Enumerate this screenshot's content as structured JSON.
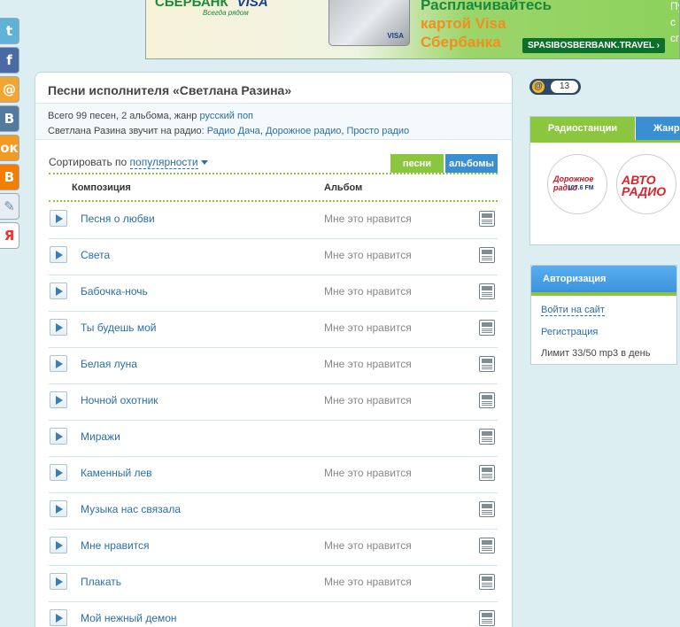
{
  "banner": {
    "bank": "СБЕРБАНК",
    "visa": "VISA",
    "slogan": "Всегда рядом",
    "card_visa": "VISA",
    "line1": "Расплачивайтесь",
    "line2": "картой Visa",
    "line3": "Сбербанка",
    "url": "SPASIBOSBERBANK.TRAVEL ›",
    "right_text1": "Пу",
    "right_text2": "с",
    "right_text3": "сп"
  },
  "social": [
    {
      "name": "twitter-icon",
      "glyph": "t"
    },
    {
      "name": "facebook-icon",
      "glyph": "f"
    },
    {
      "name": "mailru-icon",
      "glyph": "@"
    },
    {
      "name": "vkontakte-icon",
      "glyph": "B"
    },
    {
      "name": "odnoklassniki-icon",
      "glyph": "ок"
    },
    {
      "name": "blogger-icon",
      "glyph": "B"
    },
    {
      "name": "livejournal-icon",
      "glyph": "✎"
    },
    {
      "name": "yandex-icon",
      "glyph": "Я"
    }
  ],
  "main": {
    "title": "Песни исполнителя «Светлана Разина»",
    "info_prefix": "Всего 99 песен, 2 альбома, жанр ",
    "genre": "русский поп",
    "radio_prefix": "Светлана Разина звучит на радио: ",
    "radio1": "Радио Дача",
    "radio2": "Дорожное радио",
    "radio3": "Просто радио",
    "sep": ", ",
    "sort_label": "Сортировать по ",
    "sort_value": "популярности",
    "tab_songs": "песни",
    "tab_albums": "альбомы",
    "col_composition": "Композиция",
    "col_album": "Альбом"
  },
  "songs": [
    {
      "title": "Песня о любви",
      "album": "Мне это нравится"
    },
    {
      "title": "Света",
      "album": "Мне это нравится"
    },
    {
      "title": "Бабочка-ночь",
      "album": "Мне это нравится"
    },
    {
      "title": "Ты будешь мой",
      "album": "Мне это нравится"
    },
    {
      "title": "Белая луна",
      "album": "Мне это нравится"
    },
    {
      "title": "Ночной охотник",
      "album": "Мне это нравится"
    },
    {
      "title": "Миражи",
      "album": ""
    },
    {
      "title": "Каменный лев",
      "album": "Мне это нравится"
    },
    {
      "title": "Музыка нас связала",
      "album": ""
    },
    {
      "title": "Мне нравится",
      "album": "Мне это нравится"
    },
    {
      "title": "Плакать",
      "album": "Мне это нравится"
    },
    {
      "title": "Мой нежный демон",
      "album": ""
    }
  ],
  "counter": {
    "at": "@",
    "value": "13"
  },
  "radio_box": {
    "tab_stations": "Радиостанции",
    "tab_genres": "Жанр",
    "logo1_text": "Дорожное радио",
    "logo1_sub": "107.6 FM",
    "logo2_text": "АВТО РАДИО"
  },
  "auth": {
    "title": "Авторизация",
    "login": "Войти на сайт",
    "register": "Регистрация",
    "limit": "Лимит 33/50 mp3 в день"
  }
}
